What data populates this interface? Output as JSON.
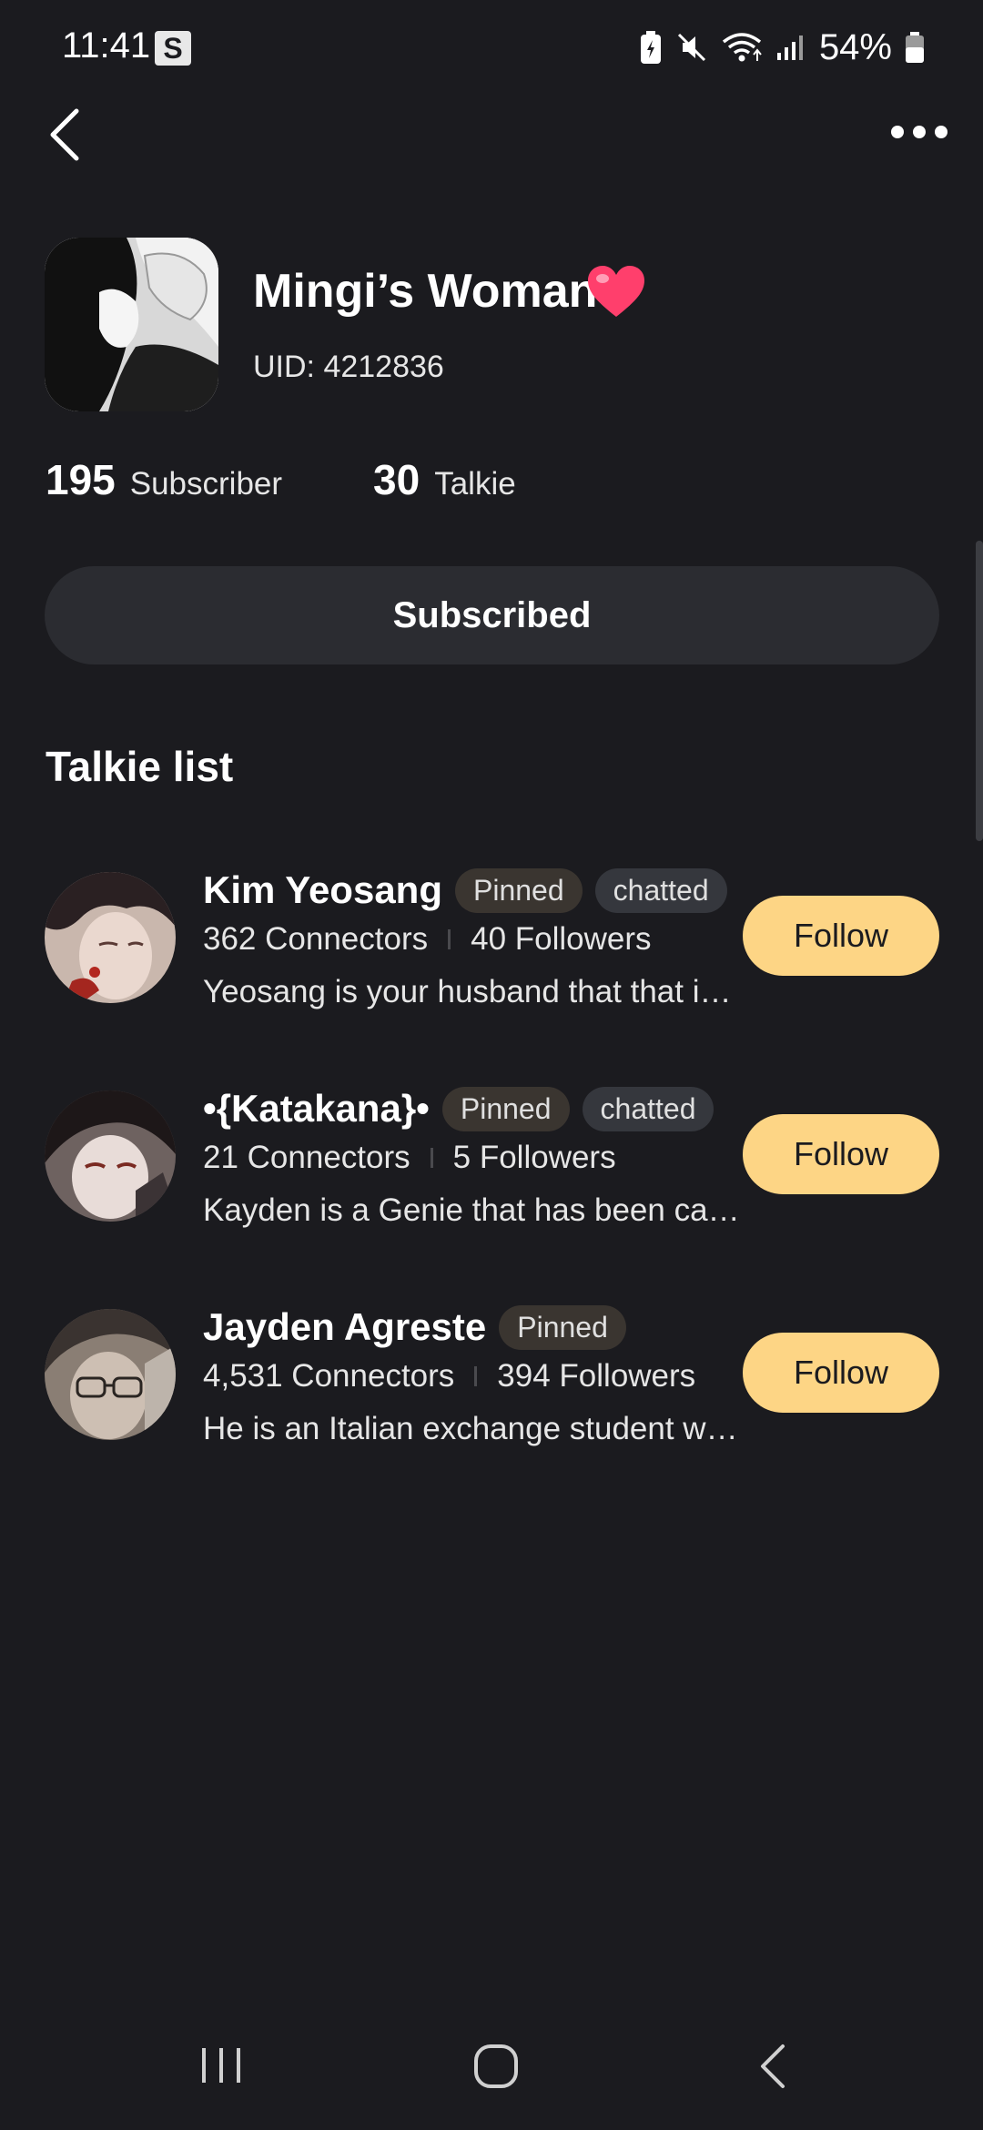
{
  "status_bar": {
    "time": "11:41",
    "app_icon_letter": "S",
    "battery_percent": "54%"
  },
  "profile": {
    "name": "Mingi’s Woman",
    "uid": "UID: 4212836",
    "subscriber_count": "195",
    "subscriber_label": "Subscriber",
    "talkie_count": "30",
    "talkie_label": "Talkie",
    "subscribe_button": "Subscribed"
  },
  "section_title": "Talkie list",
  "talkies": [
    {
      "name": "Kim Yeosang",
      "pinned": "Pinned",
      "chatted": "chatted",
      "connectors": "362 Connectors",
      "followers": "40 Followers",
      "description": "Yeosang is your husband that that is a",
      "follow_label": "Follow"
    },
    {
      "name": "•{Katakana}•",
      "pinned": "Pinned",
      "chatted": "chatted",
      "connectors": "21 Connectors",
      "followers": "5 Followers",
      "description": "Kayden is a Genie that has been captured",
      "follow_label": "Follow"
    },
    {
      "name": "Jayden Agreste",
      "pinned": "Pinned",
      "connectors": "4,531 Connectors",
      "followers": "394 Followers",
      "description": "He is an Italian exchange student who is",
      "follow_label": "Follow"
    }
  ],
  "colors": {
    "background": "#1b1b1f",
    "follow_button": "#fdd585",
    "subscribe_button": "#2b2c31"
  }
}
